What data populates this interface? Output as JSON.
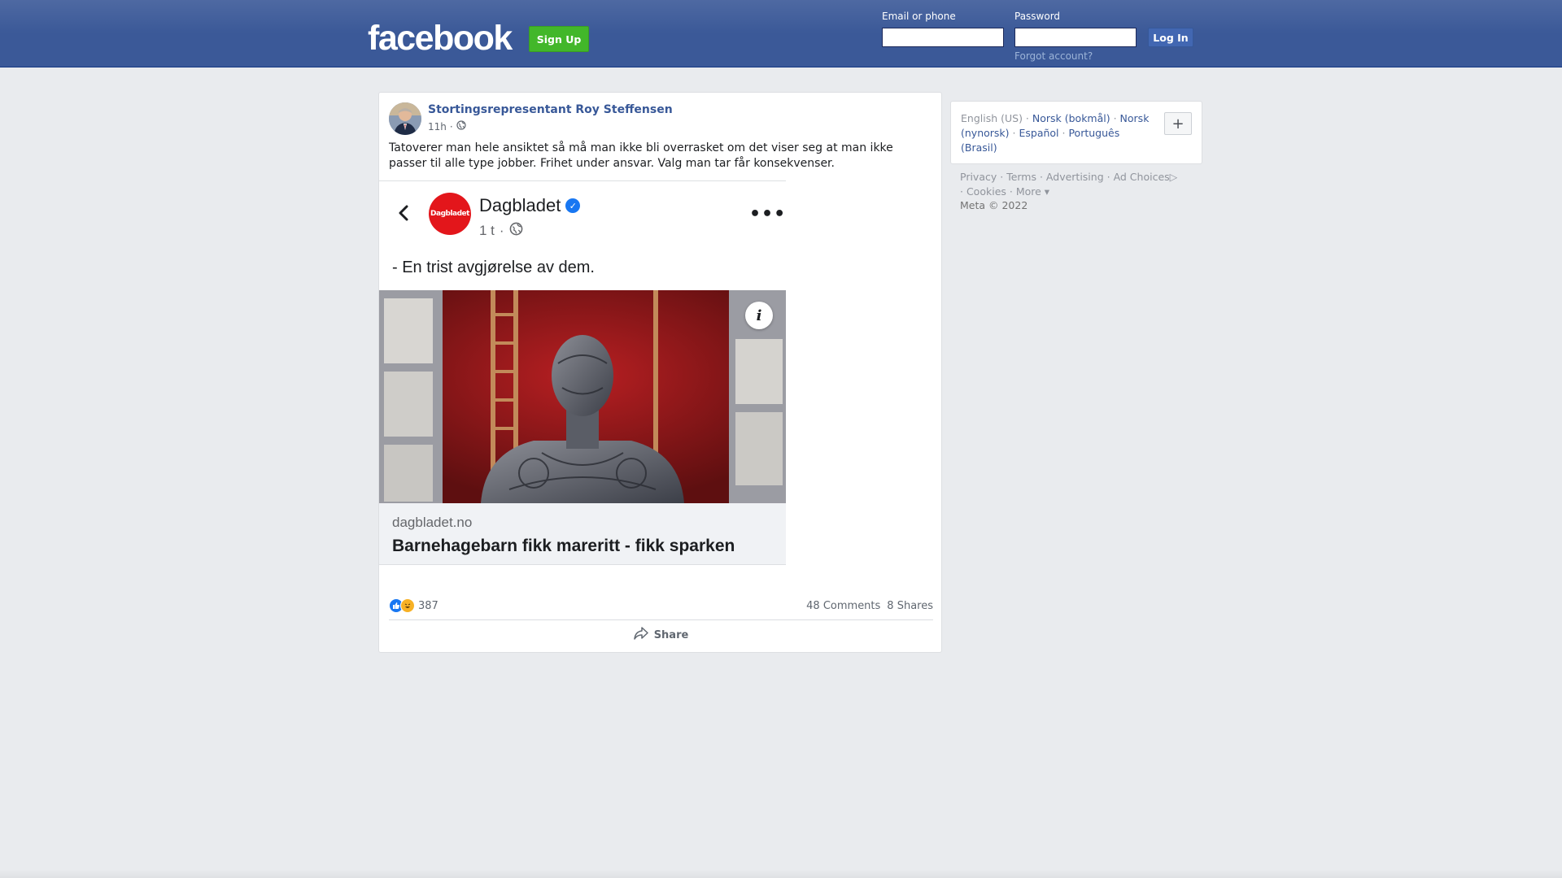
{
  "header": {
    "logo": "facebook",
    "signup_label": "Sign Up",
    "email_label": "Email or phone",
    "password_label": "Password",
    "email_value": "",
    "password_value": "",
    "login_label": "Log In",
    "forgot_label": "Forgot account?"
  },
  "post": {
    "author": "Stortingsrepresentant Roy Steffensen",
    "time": "11h",
    "separator": "·",
    "audience_icon": "globe-icon",
    "text": "Tatoverer man hele ansiktet så må man ikke bli overrasket om det viser seg at man ikke passer til alle type jobber. Frihet under ansvar. Valg man tar får konsekvenser.",
    "embedded": {
      "page_logo_text": "Dagbladet",
      "page_name": "Dagbladet",
      "time": "1 t",
      "quote": "- En trist avgjørelse av dem.",
      "info_label": "i",
      "domain": "dagbladet.no",
      "headline": "Barnehagebarn fikk mareritt - fikk sparken"
    },
    "reaction_count": "387",
    "comments": "48 Comments",
    "shares": "8 Shares",
    "share_label": "Share"
  },
  "sidebar": {
    "languages": [
      {
        "label": "English (US)",
        "current": true
      },
      {
        "label": "Norsk (bokmål)"
      },
      {
        "label": "Norsk (nynorsk)"
      },
      {
        "label": "Español"
      },
      {
        "label": "Português (Brasil)"
      }
    ],
    "plus_label": "+",
    "footer": [
      "Privacy",
      "Terms",
      "Advertising",
      "Ad Choices",
      "Cookies",
      "More"
    ],
    "copyright": "Meta © 2022"
  },
  "colors": {
    "header_blue": "#3b5998",
    "signup_green": "#42b72a",
    "link_blue": "#385898",
    "dagbladet_red": "#e3161b"
  }
}
